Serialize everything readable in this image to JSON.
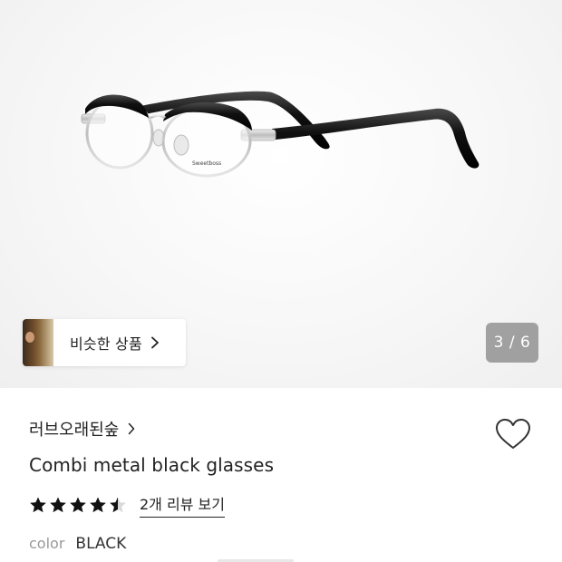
{
  "gallery": {
    "similar_label": "비슷한 상품",
    "counter": "3 / 6",
    "current_index": 3,
    "total": 6,
    "image_icon": "eyeglasses-product-image",
    "temple_stamp": "Sweetboss"
  },
  "product": {
    "brand": "러브오래된숲",
    "title": "Combi metal black glasses",
    "rating": 4.5,
    "rating_max": 5,
    "review_link": "2개 리뷰 보기",
    "option_key": "color",
    "option_value": "BLACK"
  },
  "icons": {
    "chevron": "chevron-right-icon",
    "wish": "heart-outline-icon",
    "star": "star-icon"
  },
  "colors": {
    "text": "#222222",
    "muted": "#999999",
    "counter_bg": "#6e6e6e",
    "frame": "#1a1a1a",
    "metal": "#c8c8c8"
  }
}
